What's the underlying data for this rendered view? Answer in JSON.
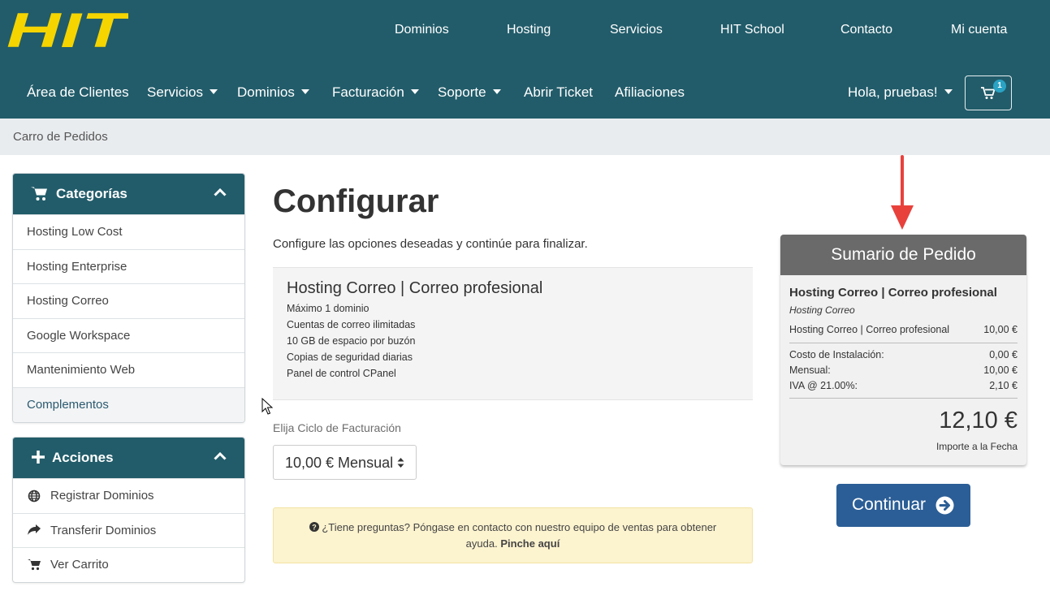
{
  "brand": {
    "logo_text": "HIT",
    "logo_color": "#f5d400",
    "header_color": "#225c6a"
  },
  "top_nav": [
    {
      "label": "Dominios"
    },
    {
      "label": "Hosting"
    },
    {
      "label": "Servicios"
    },
    {
      "label": "HIT School"
    },
    {
      "label": "Contacto"
    },
    {
      "label": "Mi cuenta"
    }
  ],
  "main_nav": {
    "items": [
      {
        "label": "Área de Clientes",
        "dropdown": false
      },
      {
        "label": "Servicios",
        "dropdown": true
      },
      {
        "label": "Dominios",
        "dropdown": true
      },
      {
        "label": "Facturación",
        "dropdown": true
      },
      {
        "label": "Soporte",
        "dropdown": true
      },
      {
        "label": "Abrir Ticket",
        "dropdown": false
      },
      {
        "label": "Afiliaciones",
        "dropdown": false
      }
    ],
    "user_menu": "Hola, pruebas!",
    "cart_count": "1"
  },
  "breadcrumb": {
    "current": "Carro de Pedidos"
  },
  "sidebar": {
    "categories": {
      "title": "Categorías",
      "items": [
        {
          "label": "Hosting Low Cost"
        },
        {
          "label": "Hosting Enterprise"
        },
        {
          "label": "Hosting Correo"
        },
        {
          "label": "Google Workspace"
        },
        {
          "label": "Mantenimiento Web"
        },
        {
          "label": "Complementos"
        }
      ]
    },
    "actions": {
      "title": "Acciones",
      "items": [
        {
          "label": "Registrar Dominios",
          "icon": "globe-icon"
        },
        {
          "label": "Transferir Dominios",
          "icon": "share-arrow-icon"
        },
        {
          "label": "Ver Carrito",
          "icon": "cart-icon"
        }
      ]
    }
  },
  "main": {
    "title": "Configurar",
    "intro": "Configure las opciones deseadas y continúe para finalizar.",
    "product": {
      "name": "Hosting Correo | Correo profesional",
      "features": [
        "Máximo 1 dominio",
        "Cuentas de correo ilimitadas",
        "10 GB de espacio por buzón",
        "Copias de seguridad diarias",
        "Panel de control CPanel"
      ]
    },
    "billing": {
      "label": "Elija Ciclo de Facturación",
      "selected": "10,00 € Mensual"
    },
    "help": {
      "text": "¿Tiene preguntas? Póngase en contacto con nuestro equipo de ventas para obtener",
      "text2": "ayuda.",
      "link": "Pinche aquí"
    }
  },
  "summary": {
    "title": "Sumario de Pedido",
    "product_name": "Hosting Correo | Correo profesional",
    "product_category": "Hosting Correo",
    "line_item": {
      "label": "Hosting Correo | Correo profesional",
      "value": "10,00 €"
    },
    "setup": {
      "label": "Costo de Instalación:",
      "value": "0,00 €"
    },
    "monthly": {
      "label": "Mensual:",
      "value": "10,00 €"
    },
    "tax": {
      "label": "IVA @ 21.00%:",
      "value": "2,10 €"
    },
    "total": "12,10 €",
    "total_label": "Importe a la Fecha"
  },
  "continue_button": {
    "label": "Continuar"
  },
  "colors": {
    "accent": "#225c6a",
    "button": "#2b5e96",
    "annotation_arrow": "#e8413c"
  }
}
